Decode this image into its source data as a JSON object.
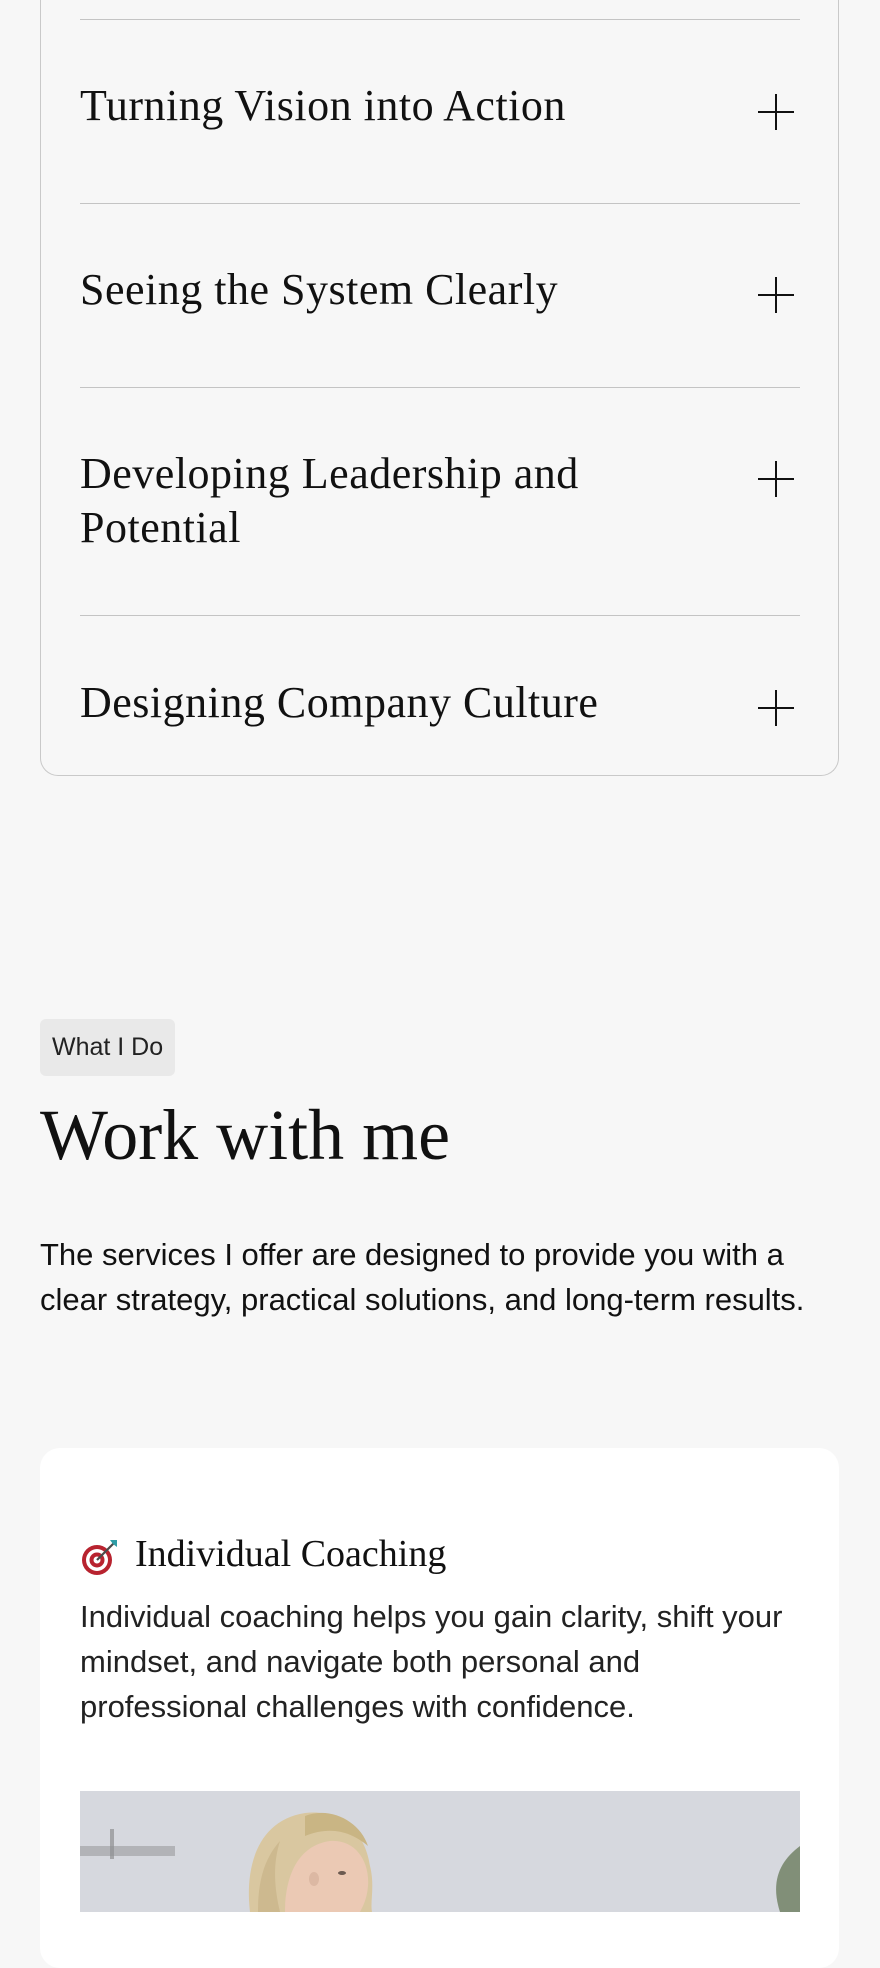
{
  "accordion": {
    "items": [
      {
        "title": "Turning Vision into Action"
      },
      {
        "title": "Seeing the System Clearly"
      },
      {
        "title": "Developing Leadership and Potential"
      },
      {
        "title": "Designing Company Culture"
      }
    ],
    "icon": "plus-icon"
  },
  "services_section": {
    "tag": "What I Do",
    "title": "Work with me",
    "description": "The services I offer are designed to provide you with a clear strategy, practical solutions, and long-term results."
  },
  "service_card": {
    "icon": "target-icon",
    "title": "Individual Coaching",
    "description": "Individual coaching helps you gain clarity, shift your mindset, and navigate both personal and professional challenges with confidence."
  },
  "colors": {
    "background": "#f7f7f7",
    "card": "#ffffff",
    "tag_background": "#e9e9e9",
    "divider": "#c4c4c4",
    "target_red": "#b8232f",
    "dart_teal": "#2e9da6"
  }
}
